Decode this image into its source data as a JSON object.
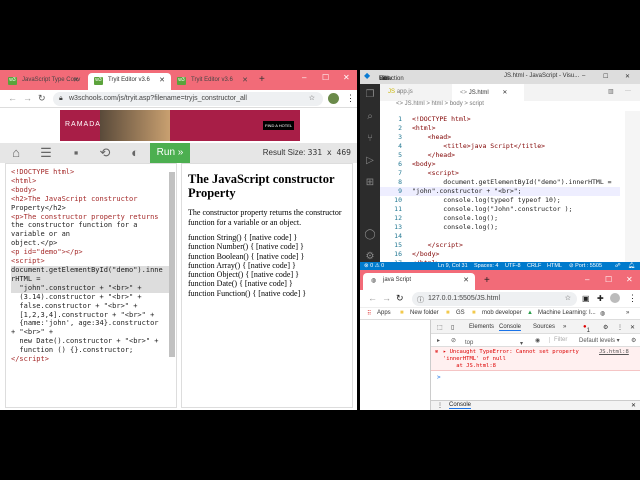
{
  "left_browser": {
    "tabs": [
      {
        "label": "JavaScript Type Conv",
        "active": false
      },
      {
        "label": "Tryit Editor v3.6",
        "active": true
      },
      {
        "label": "Tryit Editor v3.6",
        "active": false
      }
    ],
    "url": "w3schools.com/js/tryit.asp?filename=tryjs_constructor_all",
    "ad": {
      "brand": "RAMADA",
      "cta": "FIND A HOTEL"
    },
    "toolbar": {
      "run_label": "Run »",
      "result_size_label": "Result Size:",
      "result_size": "331 x 469"
    },
    "editor_lines": [
      "<!DOCTYPE html>",
      "<html>",
      "<body>",
      "",
      "<h2>The JavaScript constructor",
      "Property</h2>",
      "",
      "<p>The constructor property returns",
      "the constructor function for a",
      "variable or an",
      "object.</p>",
      "",
      "<p id=\"demo\"></p>",
      "",
      "<script>",
      "document.getElementById(\"demo\").inne",
      "rHTML =",
      "  \"john\".constructor + \"<br>\" +",
      "  (3.14).constructor + \"<br>\" +",
      "  false.constructor + \"<br>\" +",
      "  [1,2,3,4].constructor + \"<br>\" +",
      "  {name:'john', age:34}.constructor",
      "+ \"<br>\" +",
      "  new Date().constructor + \"<br>\" +",
      "  function () {}.constructor;",
      "</script>"
    ],
    "result": {
      "heading": "The JavaScript constructor Property",
      "paragraph": "The constructor property returns the constructor function for a variable or an object.",
      "output": [
        "function String() { [native code] }",
        "function Number() { [native code] }",
        "function Boolean() { [native code] }",
        "function Array() { [native code] }",
        "function Object() { [native code] }",
        "function Date() { [native code] }",
        "function Function() { [native code] }"
      ]
    }
  },
  "vscode": {
    "menu": [
      "File",
      "Edit",
      "Selection",
      "View",
      "Go",
      "···"
    ],
    "title": "JS.html - JavaScript - Visu...",
    "tabs": [
      {
        "label": "app.js",
        "active": false
      },
      {
        "label": "JS.html",
        "active": true
      }
    ],
    "breadcrumbs": "<> JS.html > html > body > script",
    "lines": [
      "<!DOCTYPE html>",
      "<html>",
      "    <head>",
      "        <title>java Script</title>",
      "    </head>",
      "<body>",
      "    <script>",
      "        document.getElementById(\"demo\").innerHTML =",
      "\"john\".constructor + \"<br>\";",
      "        console.log(typeof typeof 10);",
      "        console.log(\"John\".constructor );",
      "        console.log();",
      "        console.log();",
      "",
      "    </script>",
      "</body>",
      "</html>"
    ],
    "status": {
      "problems": "⊗ 0 ⚠ 0",
      "position": "Ln 9, Col 31",
      "spaces": "Spaces: 4",
      "encoding": "UTF-8",
      "eol": "CRLF",
      "language": "HTML",
      "port": "⊘ Port : 5505"
    }
  },
  "chrome": {
    "tab": "java Script",
    "url": "127.0.0.1:5505/JS.html",
    "bookmarks": [
      "Apps",
      "New folder",
      "GS",
      "mob developer",
      "Machine Learning: I..."
    ],
    "devtools": {
      "tabs": [
        "Elements",
        "Console",
        "Sources",
        "»"
      ],
      "error_count": "1",
      "context": "top",
      "filter_placeholder": "Filter",
      "levels": "Default levels ▾",
      "error_line1": "▸ Uncaught TypeError: Cannot set property",
      "error_line2": "'innerHTML' of null",
      "error_line3": "    at JS.html:8",
      "error_source": "JS.html:8",
      "prompt": ">",
      "drawer_tab": "Console"
    }
  }
}
